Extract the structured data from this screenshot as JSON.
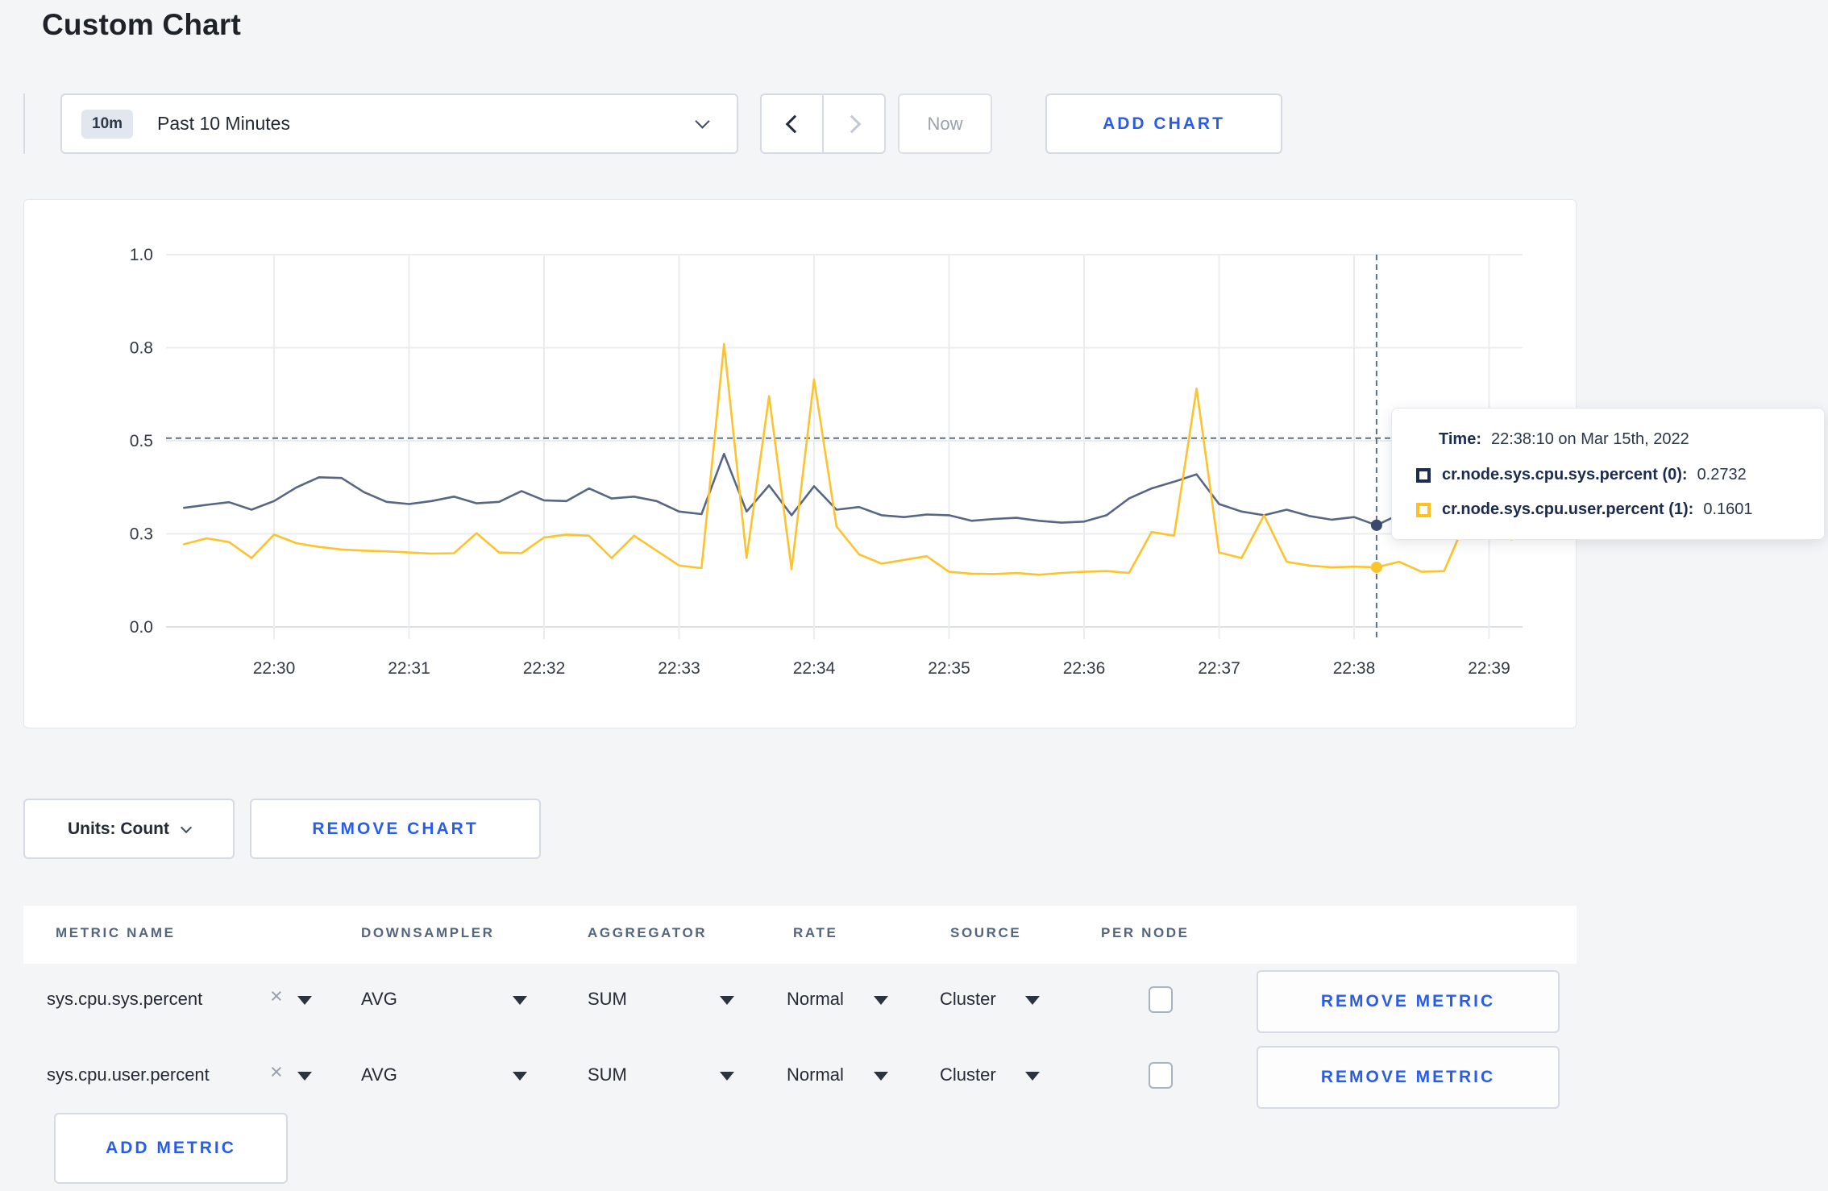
{
  "page": {
    "title": "Custom Chart",
    "background": "#f4f5f7",
    "accent_blue": "#2b5ce6"
  },
  "toolbar": {
    "timescale": {
      "badge": "10m",
      "label": "Past 10 Minutes"
    },
    "now_label": "Now",
    "add_chart_label": "ADD CHART"
  },
  "tooltip": {
    "time_label": "Time:",
    "time_value": "22:38:10 on Mar 15th, 2022",
    "series": [
      {
        "label": "cr.node.sys.cpu.sys.percent (0):",
        "value": "0.2732",
        "swatch_color": "#1c2c50"
      },
      {
        "label": "cr.node.sys.cpu.user.percent (1):",
        "value": "0.1601",
        "swatch_color": "#ffc020"
      }
    ]
  },
  "chart_controls": {
    "units_label": "Units: Count",
    "remove_chart_label": "REMOVE CHART"
  },
  "metrics_table": {
    "headers": [
      "METRIC NAME",
      "DOWNSAMPLER",
      "AGGREGATOR",
      "RATE",
      "SOURCE",
      "PER NODE"
    ],
    "rows": [
      {
        "name": "sys.cpu.sys.percent",
        "downsampler": "AVG",
        "aggregator": "SUM",
        "rate": "Normal",
        "source": "Cluster",
        "per_node_checked": false,
        "remove_label": "REMOVE METRIC"
      },
      {
        "name": "sys.cpu.user.percent",
        "downsampler": "AVG",
        "aggregator": "SUM",
        "rate": "Normal",
        "source": "Cluster",
        "per_node_checked": false,
        "remove_label": "REMOVE METRIC"
      }
    ],
    "add_metric_label": "ADD METRIC"
  },
  "chart_data": {
    "type": "line",
    "title": "",
    "xlabel": "",
    "ylabel": "",
    "ylim": [
      0,
      1
    ],
    "grid": true,
    "x_start_seconds": 20,
    "x_step_seconds": 10,
    "x_ticks": [
      {
        "t": 60,
        "label": "22:30"
      },
      {
        "t": 120,
        "label": "22:31"
      },
      {
        "t": 180,
        "label": "22:32"
      },
      {
        "t": 240,
        "label": "22:33"
      },
      {
        "t": 300,
        "label": "22:34"
      },
      {
        "t": 360,
        "label": "22:35"
      },
      {
        "t": 420,
        "label": "22:36"
      },
      {
        "t": 480,
        "label": "22:37"
      },
      {
        "t": 540,
        "label": "22:38"
      },
      {
        "t": 600,
        "label": "22:39"
      }
    ],
    "y_ticks": [
      {
        "v": 0,
        "label": "0.0"
      },
      {
        "v": 0.25,
        "label": "0.3"
      },
      {
        "v": 0.5,
        "label": "0.5"
      },
      {
        "v": 0.75,
        "label": "0.8"
      },
      {
        "v": 1.0,
        "label": "1.0"
      }
    ],
    "series": [
      {
        "name": "cr.node.sys.cpu.sys.percent",
        "color": "#586684",
        "dot_color": "#3a4a6d",
        "values": [
          0.32,
          0.328,
          0.335,
          0.315,
          0.338,
          0.375,
          0.402,
          0.4,
          0.362,
          0.336,
          0.33,
          0.338,
          0.35,
          0.332,
          0.336,
          0.365,
          0.34,
          0.338,
          0.372,
          0.345,
          0.35,
          0.338,
          0.31,
          0.303,
          0.465,
          0.31,
          0.38,
          0.3,
          0.378,
          0.315,
          0.322,
          0.3,
          0.295,
          0.302,
          0.3,
          0.285,
          0.29,
          0.293,
          0.285,
          0.28,
          0.283,
          0.3,
          0.345,
          0.372,
          0.39,
          0.41,
          0.33,
          0.31,
          0.3,
          0.315,
          0.298,
          0.288,
          0.295,
          0.2732,
          0.302,
          0.29,
          0.296,
          0.308,
          0.298,
          0.31
        ]
      },
      {
        "name": "cr.node.sys.cpu.user.percent",
        "color": "#fcc32c",
        "dot_color": "#fcc32c",
        "values": [
          0.222,
          0.238,
          0.228,
          0.185,
          0.248,
          0.225,
          0.215,
          0.208,
          0.205,
          0.203,
          0.2,
          0.197,
          0.198,
          0.252,
          0.2,
          0.198,
          0.24,
          0.248,
          0.245,
          0.185,
          0.245,
          0.205,
          0.165,
          0.158,
          0.76,
          0.185,
          0.62,
          0.155,
          0.665,
          0.27,
          0.195,
          0.17,
          0.18,
          0.19,
          0.148,
          0.143,
          0.142,
          0.145,
          0.14,
          0.145,
          0.148,
          0.15,
          0.145,
          0.255,
          0.245,
          0.64,
          0.2,
          0.185,
          0.3,
          0.175,
          0.165,
          0.16,
          0.162,
          0.1601,
          0.175,
          0.148,
          0.15,
          0.29,
          0.27,
          0.235
        ]
      }
    ],
    "crosshair": {
      "t": 550,
      "time_label": "22:38:10 on Mar 15th, 2022",
      "hover_y_value": 0.507,
      "points": [
        {
          "series": 0,
          "value": 0.2732
        },
        {
          "series": 1,
          "value": 0.1601
        }
      ]
    },
    "legend_position": "tooltip"
  }
}
